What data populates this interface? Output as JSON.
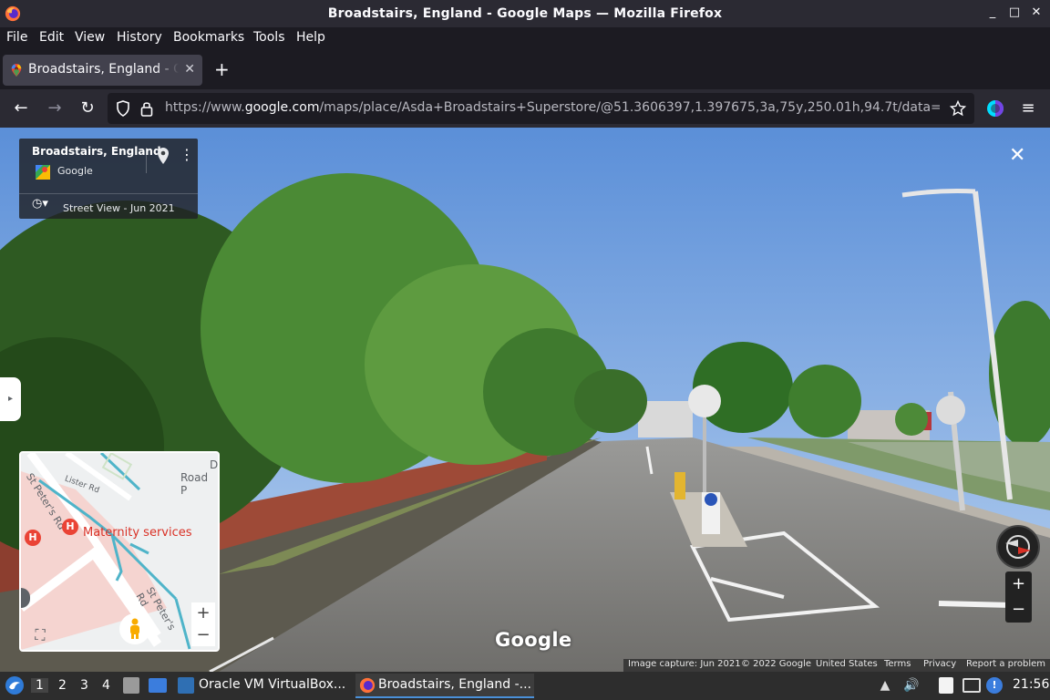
{
  "window": {
    "title": "Broadstairs, England - Google Maps — Mozilla Firefox",
    "wm_buttons": [
      "_",
      "□",
      "✕"
    ]
  },
  "menubar": {
    "items": [
      "File",
      "Edit",
      "View",
      "History",
      "Bookmarks",
      "Tools",
      "Help"
    ]
  },
  "tabs": [
    {
      "title": "Broadstairs, England - Google Maps",
      "close": "✕",
      "icon": "google-maps-favicon"
    }
  ],
  "newtab_label": "+",
  "navbar": {
    "back": "←",
    "forward": "→",
    "reload": "↻",
    "url_prefix": "https://www.",
    "url_domain": "google.com",
    "url_path": "/maps/place/Asda+Broadstairs+Superstore/@51.3606397,1.397675,3a,75y,250.01h,94.7t/data=",
    "menu": "≡"
  },
  "streetview": {
    "place_title": "Broadstairs, England",
    "provider": "Google",
    "date_label": "Street View - Jun 2021",
    "close": "✕",
    "side_toggle": "▸",
    "google_logo": "Google",
    "minimap": {
      "labels": [
        "St Peter's Rd",
        "Lister Rd",
        "Maternity services",
        "St Peter's Rd",
        "Road P",
        "D"
      ],
      "hospital_marker": "H",
      "zoom_in": "+",
      "zoom_out": "−"
    },
    "zoom_in": "+",
    "zoom_out": "−",
    "attribution": [
      "Image capture: Jun 2021",
      "© 2022 Google",
      "United States",
      "Terms",
      "Privacy",
      "Report a problem"
    ]
  },
  "taskbar": {
    "workspaces": [
      "1",
      "2",
      "3",
      "4"
    ],
    "tasks": [
      {
        "label": "Oracle VM VirtualBox...",
        "icon": "virtualbox-icon"
      },
      {
        "label": "Broadstairs, England -...",
        "icon": "firefox-icon"
      }
    ],
    "time": "21:56"
  }
}
